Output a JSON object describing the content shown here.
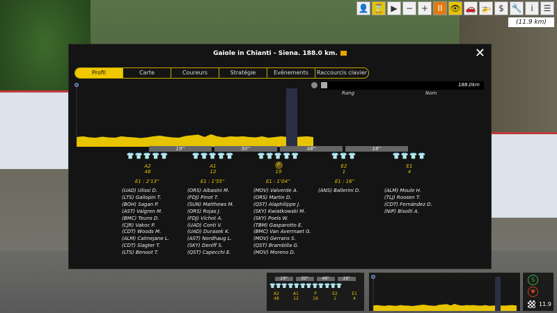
{
  "toolbar": {
    "speed_label": "▶",
    "minus_label": "−",
    "plus_label": "+",
    "pause_label": "II",
    "info_label": "i",
    "menu_label": "☰",
    "distance_badge": "(11.9 km)"
  },
  "modal": {
    "title": "Gaiole in Chianti - Siena. 188.0 km.",
    "close_label": "✕",
    "tabs": [
      "Profil",
      "Carte",
      "Coureurs",
      "Stratégie",
      "Evénements",
      "Raccourcis clavier"
    ],
    "active_tab": "Profil"
  },
  "profile": {
    "total_distance": "188.0km",
    "col_rank": "Rang",
    "col_name": "Nom",
    "elevation": [
      0.28,
      0.3,
      0.27,
      0.26,
      0.29,
      0.27,
      0.26,
      0.3,
      0.28,
      0.27,
      0.25,
      0.27,
      0.3,
      0.32,
      0.29,
      0.27,
      0.26,
      0.31,
      0.33,
      0.35,
      0.28,
      0.36,
      0.3,
      0.27,
      0.3,
      0.29,
      0.3,
      0.28,
      0.27,
      0.3,
      0.26,
      0.28,
      0.3,
      0.28,
      0.27,
      0.29,
      0.3,
      0.28
    ]
  },
  "gaps": [
    "19''",
    "50''",
    "48''",
    "16''"
  ],
  "groups": [
    {
      "jerseys": "👕👕👕👕",
      "orange": "👕",
      "sprint_code": "A2",
      "sprint_value": "48",
      "gap": "E1 : 2'13''",
      "riders": [
        "(UAD) Ulissi D.",
        "(LTS) Gallopin T.",
        "(BOH) Sagan P.",
        "(AST) Valgren M.",
        "(BMC) Teuns D.",
        "(CJR) Vakoc P.",
        "(CDT) Woods M.",
        "(ALM) Calmejane L.",
        "(CDT) Slagter T.",
        "(LTS) Benoot T."
      ]
    },
    {
      "jerseys": "👕👕👕👕",
      "orange": "👕",
      "sprint_code": "A1",
      "sprint_value": "12",
      "gap": "E1 : 1'55''",
      "riders": [
        "(ORS) Albasini M.",
        "(FDJ) Pinot T.",
        "(SUN) Matthews M.",
        "(ORS) Rojas J.",
        "(FDJ) Vichot A.",
        "(UAD) Conti V.",
        "(UAD) Durasek K.",
        "(AST) Nordhaug L.",
        "(SKY) Deniff S.",
        "(QST) Capecchi E."
      ]
    },
    {
      "jerseys": "👕👕👕👕",
      "orange": "👕",
      "sprint_code": "P",
      "sprint_value": "19",
      "gap": "E1 : 1'04''",
      "riders": [
        "(MOV) Valverde A.",
        "(ORS) Martin D.",
        "(QST) Alaphilippe J.",
        "(SKY) Kwiatkowski M.",
        "(SKY) Poels W.",
        "(TBM) Gasparotto E.",
        "(BMC) Van Avermaet G.",
        "(MOV) Gerrans S.",
        "(QST) Brambilla G.",
        "(MOV) Moreno D."
      ]
    },
    {
      "jerseys": "👕👕👕",
      "orange": "",
      "sprint_code": "E2",
      "sprint_value": "1",
      "gap": "E1 : 16''",
      "riders": [
        "(ANS) Ballerini D."
      ]
    },
    {
      "jerseys": "👕👕👕👕",
      "orange": "",
      "sprint_code": "E1",
      "sprint_value": "4",
      "gap": "",
      "riders": [
        "(ALM) Moule H.",
        "(TLJ) Roosen T.",
        "(CDT) Fernández D.",
        "(NIP) Bisolti A."
      ]
    }
  ],
  "mini": {
    "gaps": [
      "19''",
      "50''",
      "48''",
      "16''"
    ],
    "codes": [
      "A2",
      "A1",
      "P",
      "E2",
      "E1"
    ],
    "values": [
      "48",
      "12",
      "19",
      "1",
      "4"
    ],
    "side_button_top": "S",
    "side_distance": "11.9"
  }
}
